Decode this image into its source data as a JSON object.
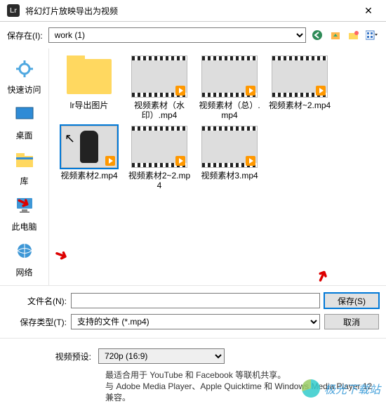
{
  "window": {
    "title": "将幻灯片放映导出为视频",
    "logo_text": "Lr"
  },
  "toolbar": {
    "save_in_label": "保存在(I):",
    "location_value": "work (1)"
  },
  "sidebar": {
    "items": [
      {
        "label": "快速访问"
      },
      {
        "label": "桌面"
      },
      {
        "label": "库"
      },
      {
        "label": "此电脑"
      },
      {
        "label": "网络"
      }
    ]
  },
  "files": [
    {
      "name": "lr导出图片",
      "type": "folder"
    },
    {
      "name": "视频素材（水印）.mp4",
      "type": "video",
      "thumb": "city"
    },
    {
      "name": "视频素材（总）.mp4",
      "type": "video",
      "thumb": "walk"
    },
    {
      "name": "视频素材~2.mp4",
      "type": "video",
      "thumb": "leaf"
    },
    {
      "name": "视频素材2.mp4",
      "type": "video",
      "thumb": "green",
      "selected": true
    },
    {
      "name": "视频素材2~2.mp4",
      "type": "video",
      "thumb": "sky"
    },
    {
      "name": "视频素材3.mp4",
      "type": "video",
      "thumb": "glass"
    }
  ],
  "form": {
    "filename_label": "文件名(N):",
    "filename_value": "",
    "filetype_label": "保存类型(T):",
    "filetype_value": "支持的文件 (*.mp4)",
    "save_button": "保存(S)",
    "cancel_button": "取消"
  },
  "preset": {
    "label": "视频预设:",
    "value": "720p (16:9)",
    "hint1": "最适合用于 YouTube 和 Facebook 等联机共享。",
    "hint2": "与 Adobe Media Player、Apple Quicktime 和 Windows Media Player 12 兼容。"
  },
  "watermark": {
    "text": "极光下载站"
  }
}
